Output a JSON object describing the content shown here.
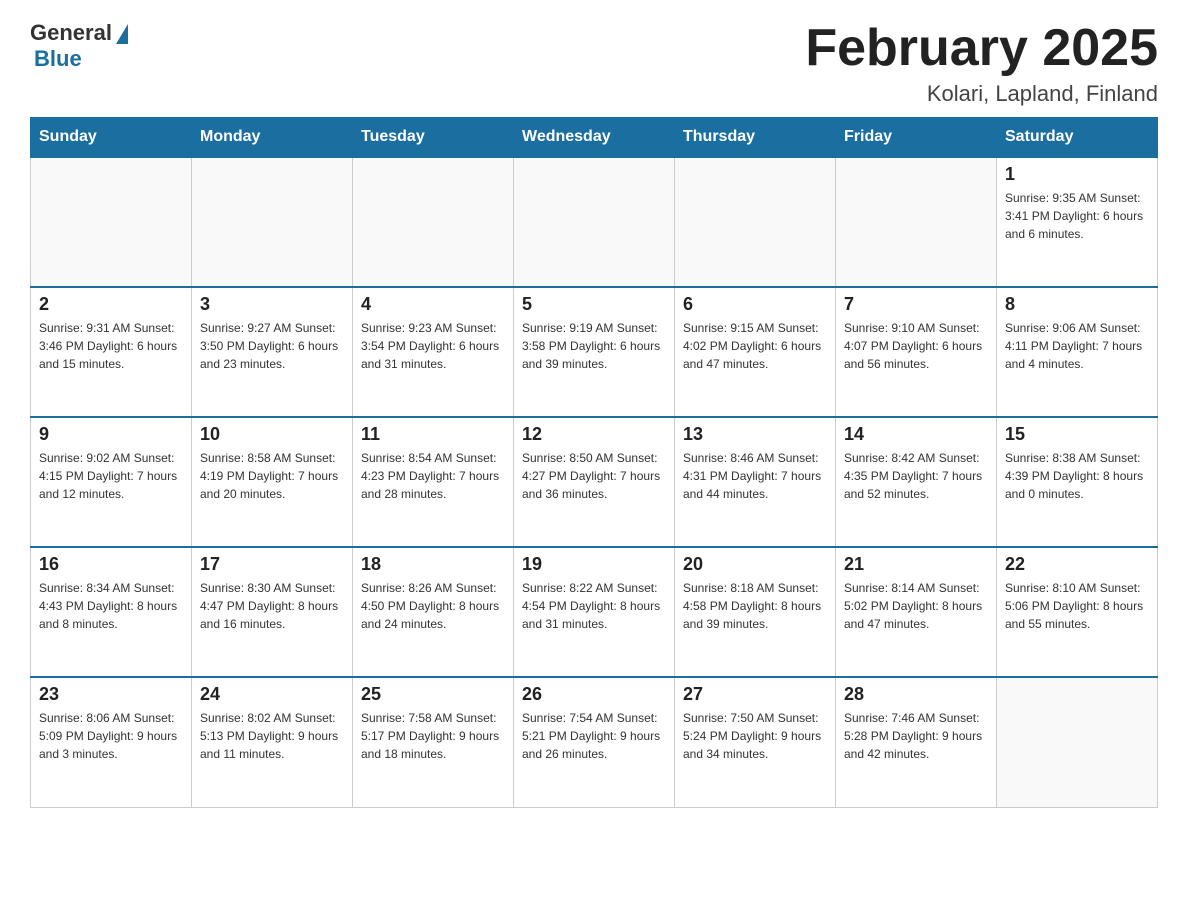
{
  "logo": {
    "general": "General",
    "blue": "Blue"
  },
  "title": "February 2025",
  "subtitle": "Kolari, Lapland, Finland",
  "weekdays": [
    "Sunday",
    "Monday",
    "Tuesday",
    "Wednesday",
    "Thursday",
    "Friday",
    "Saturday"
  ],
  "weeks": [
    [
      {
        "day": "",
        "info": ""
      },
      {
        "day": "",
        "info": ""
      },
      {
        "day": "",
        "info": ""
      },
      {
        "day": "",
        "info": ""
      },
      {
        "day": "",
        "info": ""
      },
      {
        "day": "",
        "info": ""
      },
      {
        "day": "1",
        "info": "Sunrise: 9:35 AM\nSunset: 3:41 PM\nDaylight: 6 hours and 6 minutes."
      }
    ],
    [
      {
        "day": "2",
        "info": "Sunrise: 9:31 AM\nSunset: 3:46 PM\nDaylight: 6 hours and 15 minutes."
      },
      {
        "day": "3",
        "info": "Sunrise: 9:27 AM\nSunset: 3:50 PM\nDaylight: 6 hours and 23 minutes."
      },
      {
        "day": "4",
        "info": "Sunrise: 9:23 AM\nSunset: 3:54 PM\nDaylight: 6 hours and 31 minutes."
      },
      {
        "day": "5",
        "info": "Sunrise: 9:19 AM\nSunset: 3:58 PM\nDaylight: 6 hours and 39 minutes."
      },
      {
        "day": "6",
        "info": "Sunrise: 9:15 AM\nSunset: 4:02 PM\nDaylight: 6 hours and 47 minutes."
      },
      {
        "day": "7",
        "info": "Sunrise: 9:10 AM\nSunset: 4:07 PM\nDaylight: 6 hours and 56 minutes."
      },
      {
        "day": "8",
        "info": "Sunrise: 9:06 AM\nSunset: 4:11 PM\nDaylight: 7 hours and 4 minutes."
      }
    ],
    [
      {
        "day": "9",
        "info": "Sunrise: 9:02 AM\nSunset: 4:15 PM\nDaylight: 7 hours and 12 minutes."
      },
      {
        "day": "10",
        "info": "Sunrise: 8:58 AM\nSunset: 4:19 PM\nDaylight: 7 hours and 20 minutes."
      },
      {
        "day": "11",
        "info": "Sunrise: 8:54 AM\nSunset: 4:23 PM\nDaylight: 7 hours and 28 minutes."
      },
      {
        "day": "12",
        "info": "Sunrise: 8:50 AM\nSunset: 4:27 PM\nDaylight: 7 hours and 36 minutes."
      },
      {
        "day": "13",
        "info": "Sunrise: 8:46 AM\nSunset: 4:31 PM\nDaylight: 7 hours and 44 minutes."
      },
      {
        "day": "14",
        "info": "Sunrise: 8:42 AM\nSunset: 4:35 PM\nDaylight: 7 hours and 52 minutes."
      },
      {
        "day": "15",
        "info": "Sunrise: 8:38 AM\nSunset: 4:39 PM\nDaylight: 8 hours and 0 minutes."
      }
    ],
    [
      {
        "day": "16",
        "info": "Sunrise: 8:34 AM\nSunset: 4:43 PM\nDaylight: 8 hours and 8 minutes."
      },
      {
        "day": "17",
        "info": "Sunrise: 8:30 AM\nSunset: 4:47 PM\nDaylight: 8 hours and 16 minutes."
      },
      {
        "day": "18",
        "info": "Sunrise: 8:26 AM\nSunset: 4:50 PM\nDaylight: 8 hours and 24 minutes."
      },
      {
        "day": "19",
        "info": "Sunrise: 8:22 AM\nSunset: 4:54 PM\nDaylight: 8 hours and 31 minutes."
      },
      {
        "day": "20",
        "info": "Sunrise: 8:18 AM\nSunset: 4:58 PM\nDaylight: 8 hours and 39 minutes."
      },
      {
        "day": "21",
        "info": "Sunrise: 8:14 AM\nSunset: 5:02 PM\nDaylight: 8 hours and 47 minutes."
      },
      {
        "day": "22",
        "info": "Sunrise: 8:10 AM\nSunset: 5:06 PM\nDaylight: 8 hours and 55 minutes."
      }
    ],
    [
      {
        "day": "23",
        "info": "Sunrise: 8:06 AM\nSunset: 5:09 PM\nDaylight: 9 hours and 3 minutes."
      },
      {
        "day": "24",
        "info": "Sunrise: 8:02 AM\nSunset: 5:13 PM\nDaylight: 9 hours and 11 minutes."
      },
      {
        "day": "25",
        "info": "Sunrise: 7:58 AM\nSunset: 5:17 PM\nDaylight: 9 hours and 18 minutes."
      },
      {
        "day": "26",
        "info": "Sunrise: 7:54 AM\nSunset: 5:21 PM\nDaylight: 9 hours and 26 minutes."
      },
      {
        "day": "27",
        "info": "Sunrise: 7:50 AM\nSunset: 5:24 PM\nDaylight: 9 hours and 34 minutes."
      },
      {
        "day": "28",
        "info": "Sunrise: 7:46 AM\nSunset: 5:28 PM\nDaylight: 9 hours and 42 minutes."
      },
      {
        "day": "",
        "info": ""
      }
    ]
  ]
}
